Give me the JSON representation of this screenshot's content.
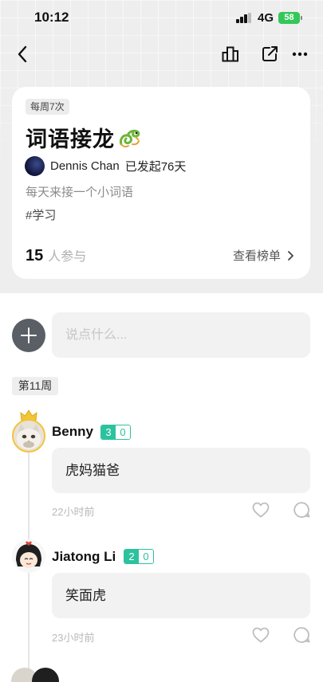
{
  "status_bar": {
    "time": "10:12",
    "network": "4G",
    "battery": "58"
  },
  "challenge": {
    "frequency": "每周7次",
    "title": "词语接龙",
    "author": "Dennis Chan",
    "started": "已发起76天",
    "description": "每天来接一个小词语",
    "hashtag": "#学习",
    "participants_count": "15",
    "participants_label": "人参与",
    "leaderboard_label": "查看榜单"
  },
  "composer": {
    "placeholder": "说点什么..."
  },
  "week_label": "第11周",
  "posts": [
    {
      "user": "Benny",
      "badge_a": "3",
      "badge_b": "0",
      "content": "虎妈猫爸",
      "time": "22小时前"
    },
    {
      "user": "Jiatong Li",
      "badge_a": "2",
      "badge_b": "0",
      "content": "笑面虎",
      "time": "23小时前"
    }
  ],
  "colors": {
    "accent": "#2cc29e",
    "crown": "#f2c437",
    "battery": "#34c759"
  },
  "icons": [
    "back-icon",
    "stats-icon",
    "share-icon",
    "more-icon",
    "plus-icon",
    "heart-icon",
    "comment-icon",
    "chevron-right-icon"
  ]
}
